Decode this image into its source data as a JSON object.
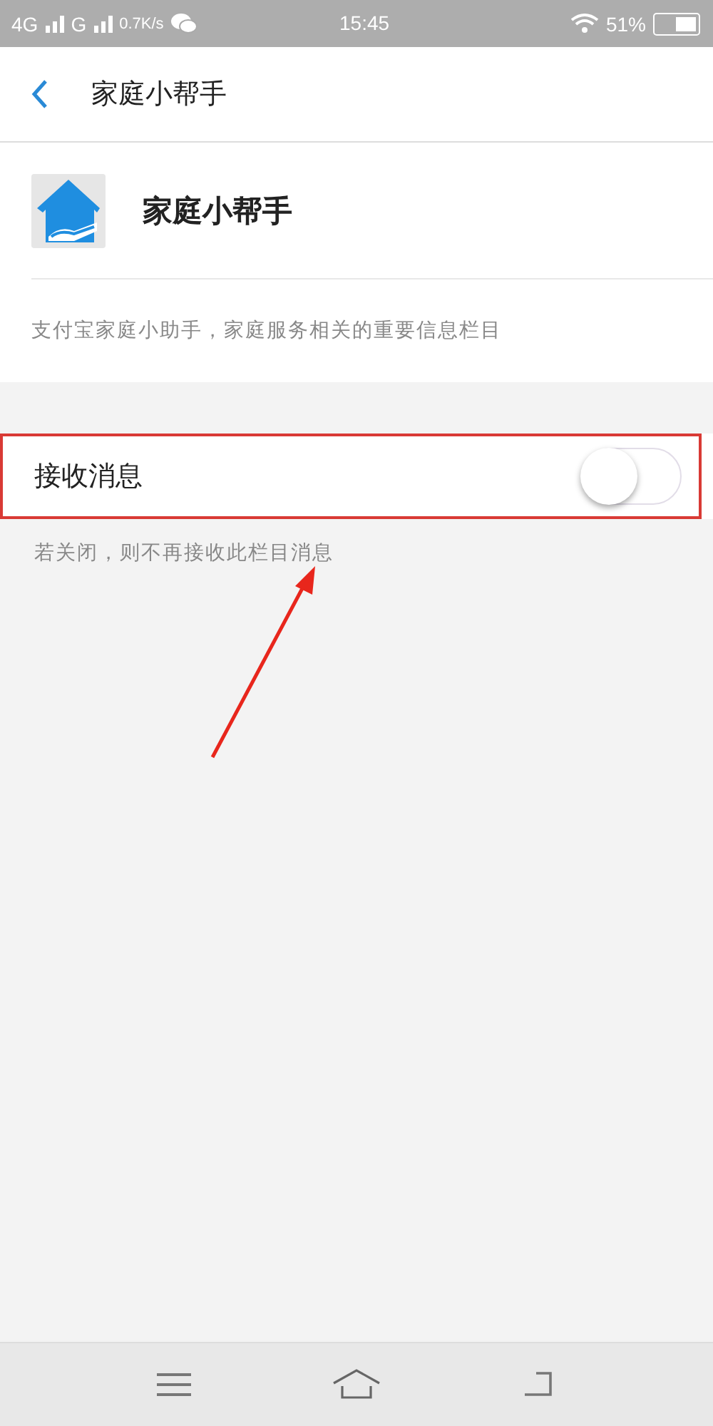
{
  "status_bar": {
    "network_1": "4G",
    "network_2": "G",
    "speed": "0.7K/s",
    "time": "15:45",
    "battery": "51%"
  },
  "header": {
    "title": "家庭小帮手"
  },
  "service": {
    "name": "家庭小帮手",
    "description": "支付宝家庭小助手，家庭服务相关的重要信息栏目"
  },
  "settings": [
    {
      "label": "接收消息",
      "on": false,
      "hint": "若关闭，则不再接收此栏目消息"
    }
  ]
}
